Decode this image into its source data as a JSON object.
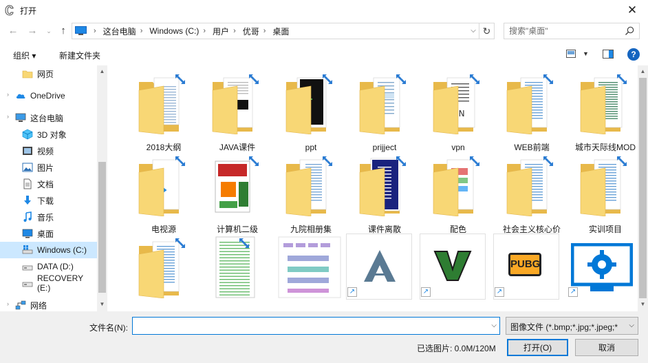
{
  "window": {
    "title": "打开",
    "close_glyph": "✕"
  },
  "address_bar": {
    "back_glyph": "←",
    "forward_glyph": "→",
    "up_glyph": "↑",
    "breadcrumbs": [
      "这台电脑",
      "Windows (C:)",
      "用户",
      "优哥",
      "桌面"
    ],
    "separator_glyph": "›",
    "dropdown_glyph": "⌵",
    "refresh_glyph": "↻"
  },
  "search": {
    "placeholder": "搜索\"桌面\""
  },
  "toolbar": {
    "organize_label": "组织 ▾",
    "new_folder_label": "新建文件夹",
    "help_glyph": "?"
  },
  "nav": {
    "items": [
      {
        "label": "网页",
        "icon": "folder-icon"
      },
      {
        "label": "OneDrive",
        "icon": "cloud-icon"
      },
      {
        "label": "这台电脑",
        "icon": "computer-icon"
      },
      {
        "label": "3D 对象",
        "icon": "cube-icon"
      },
      {
        "label": "视频",
        "icon": "video-icon"
      },
      {
        "label": "图片",
        "icon": "picture-icon"
      },
      {
        "label": "文档",
        "icon": "document-icon"
      },
      {
        "label": "下载",
        "icon": "download-icon"
      },
      {
        "label": "音乐",
        "icon": "music-icon"
      },
      {
        "label": "桌面",
        "icon": "desktop-icon"
      },
      {
        "label": "Windows (C:)",
        "icon": "windows-drive-icon",
        "selected": true
      },
      {
        "label": "DATA (D:)",
        "icon": "drive-icon"
      },
      {
        "label": "RECOVERY (E:)",
        "icon": "drive-icon"
      },
      {
        "label": "网络",
        "icon": "network-icon"
      }
    ]
  },
  "files": {
    "row1": [
      "2018大纲",
      "JAVA课件",
      "ppt",
      "prijject",
      "vpn",
      "WEB前端",
      "城市天际线MOD"
    ],
    "row2": [
      "电视源",
      "计算机二级\nOFFICE",
      "九院相册集",
      "课件离散",
      "配色",
      "社会主义核心价\n值观",
      "实训项目"
    ],
    "row3": [
      "",
      "",
      "",
      "",
      "",
      "",
      ""
    ],
    "pubg_text": "PUBG"
  },
  "bottom": {
    "filename_label": "文件名(N):",
    "filename_value": "",
    "filetype_value": "图像文件 (*.bmp;*.jpg;*.jpeg;*",
    "selected_info": "已选图片: 0.0M/120M",
    "open_label": "打开(O)",
    "cancel_label": "取消"
  },
  "colors": {
    "accent": "#0078d7",
    "folder": "#f8d775",
    "selected_nav": "#cce8ff",
    "sync_badge": "#2b7cd3"
  }
}
